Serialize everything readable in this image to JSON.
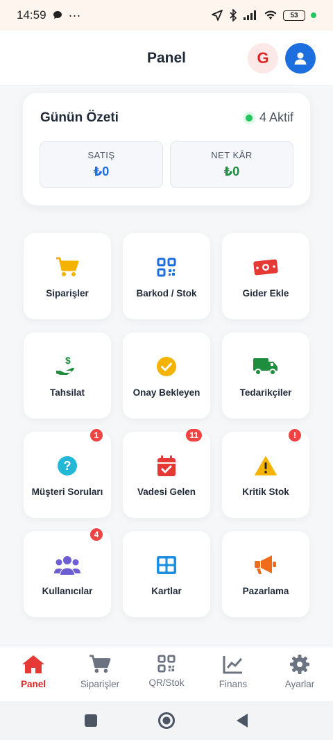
{
  "status_bar": {
    "time": "14:59",
    "dots": "···",
    "battery": "53"
  },
  "header": {
    "title": "Panel",
    "g_letter": "G"
  },
  "summary": {
    "title": "Günün Özeti",
    "active_text": "4 Aktif",
    "sales_label": "SATIŞ",
    "sales_value": "₺0",
    "profit_label": "NET KÂR",
    "profit_value": "₺0"
  },
  "tiles": [
    {
      "label": "Siparişler",
      "icon": "cart-icon",
      "color": "#f5b301"
    },
    {
      "label": "Barkod / Stok",
      "icon": "qr-icon",
      "color": "#1d6fe0"
    },
    {
      "label": "Gider Ekle",
      "icon": "money-icon",
      "color": "#e53935"
    },
    {
      "label": "Tahsilat",
      "icon": "hand-dollar-icon",
      "color": "#1e8e3e"
    },
    {
      "label": "Onay Bekleyen",
      "icon": "check-circle-icon",
      "color": "#f5b301"
    },
    {
      "label": "Tedarikçiler",
      "icon": "truck-icon",
      "color": "#1e8e3e"
    },
    {
      "label": "Müşteri Soruları",
      "icon": "question-icon",
      "color": "#22b8d6",
      "badge": "1"
    },
    {
      "label": "Vadesi Gelen",
      "icon": "calendar-check-icon",
      "color": "#e53935",
      "badge": "11"
    },
    {
      "label": "Kritik Stok",
      "icon": "warning-icon",
      "color": "#f5b301",
      "badge": "!"
    },
    {
      "label": "Kullanıcılar",
      "icon": "users-icon",
      "color": "#6d5dd3",
      "badge": "4"
    },
    {
      "label": "Kartlar",
      "icon": "grid-icon",
      "color": "#1d8fe0"
    },
    {
      "label": "Pazarlama",
      "icon": "megaphone-icon",
      "color": "#ef6c1a"
    }
  ],
  "bottom_nav": [
    {
      "label": "Panel",
      "icon": "home-icon",
      "active": true
    },
    {
      "label": "Siparişler",
      "icon": "cart-icon"
    },
    {
      "label": "QR/Stok",
      "icon": "qr-icon"
    },
    {
      "label": "Finans",
      "icon": "chart-line-icon"
    },
    {
      "label": "Ayarlar",
      "icon": "gear-icon"
    }
  ],
  "colors": {
    "accent_red": "#dc2626",
    "primary_blue": "#1d6fe0",
    "sales_blue": "#1d6fe0",
    "profit_green": "#1e8e3e",
    "inactive_gray": "#6b7280"
  }
}
